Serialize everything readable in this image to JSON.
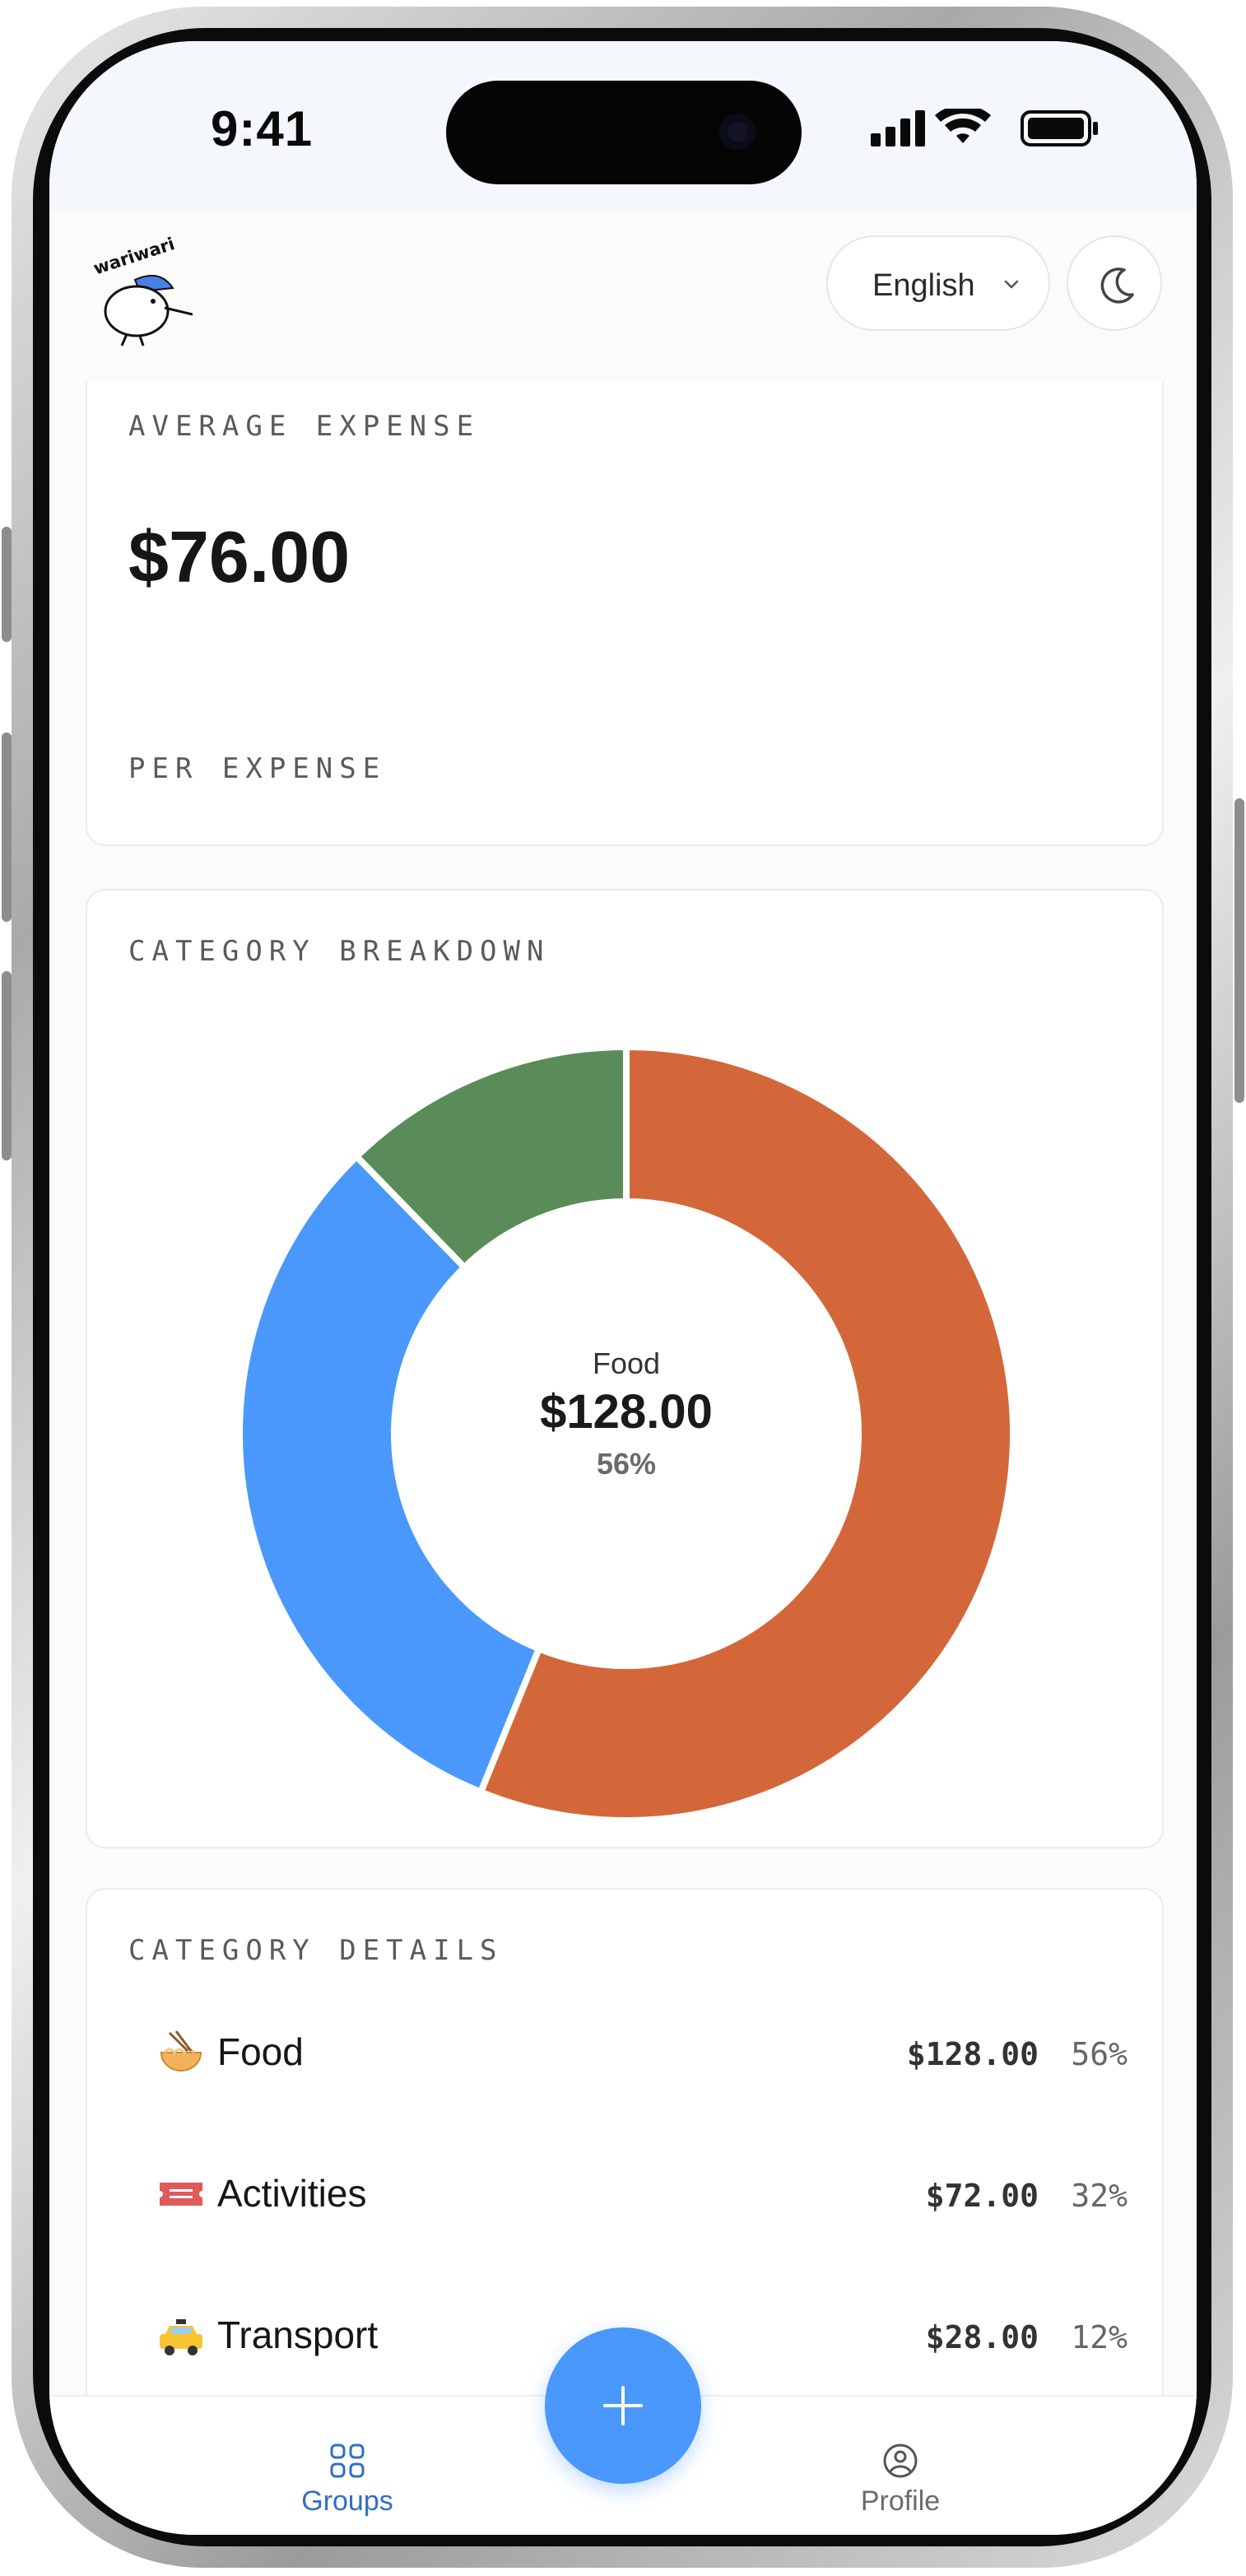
{
  "status_bar": {
    "time": "9:41"
  },
  "header": {
    "brand": "wariwari",
    "language": "English"
  },
  "average_card": {
    "label": "AVERAGE EXPENSE",
    "amount": "$76.00",
    "sublabel": "PER EXPENSE"
  },
  "breakdown_card": {
    "label": "CATEGORY BREAKDOWN",
    "center": {
      "name": "Food",
      "amount": "$128.00",
      "percent": "56%"
    }
  },
  "chart_data": {
    "type": "pie",
    "categories": [
      "Food",
      "Activities",
      "Transport"
    ],
    "values": [
      128,
      72,
      28
    ],
    "percents": [
      56,
      32,
      12
    ],
    "colors": [
      "#d4673a",
      "#4a98fb",
      "#5a8c5a"
    ],
    "donut": true
  },
  "details_card": {
    "label": "CATEGORY DETAILS",
    "rows": [
      {
        "icon": "noodle-bowl-icon",
        "name": "Food",
        "amount": "$128.00",
        "percent": "56%"
      },
      {
        "icon": "ticket-icon",
        "name": "Activities",
        "amount": "$72.00",
        "percent": "32%"
      },
      {
        "icon": "taxi-icon",
        "name": "Transport",
        "amount": "$28.00",
        "percent": "12%"
      }
    ]
  },
  "bottom_nav": {
    "groups_label": "Groups",
    "profile_label": "Profile",
    "active": "Groups",
    "active_color": "#2f6fc5",
    "inactive_color": "#6b6b6b"
  }
}
